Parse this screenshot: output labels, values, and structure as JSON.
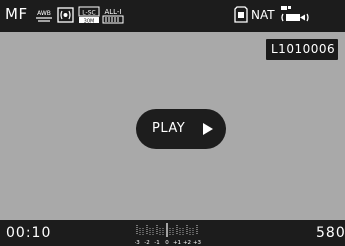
{
  "status_bar": {
    "focus_mode": "MF",
    "wb_badge": "AWB",
    "af_mode_badge": "L-SC 30M",
    "exposure_badge": "ALL-I",
    "film_style": "NAT"
  },
  "file": {
    "name": "L1010006"
  },
  "player": {
    "play_label": "PLAY"
  },
  "footer": {
    "duration": "00:10",
    "remaining": "580",
    "ev_scale_labels": [
      "-3",
      "-2",
      "-1",
      "0",
      "+1",
      "+2",
      "+3"
    ]
  },
  "colors": {
    "viewport_bg": "#a9a9a9",
    "bar_bg": "#1c1c1c",
    "button_bg": "#1d1d1d",
    "text": "#ffffff"
  }
}
